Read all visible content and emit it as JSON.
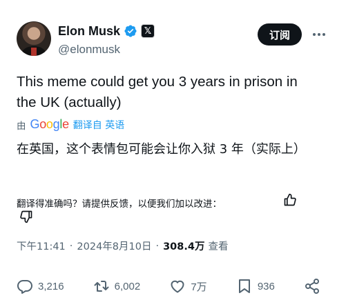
{
  "author": {
    "display_name": "Elon Musk",
    "handle": "@elonmusk",
    "verified_icon": "verified-badge-icon",
    "affiliate_icon": "x-logo-icon",
    "brand_color": "#1d9bf0"
  },
  "header": {
    "follow_label": "订阅",
    "more_icon": "more-horizontal-icon"
  },
  "tweet": {
    "text": "This meme could get you 3 years in prison in the UK (actually)"
  },
  "translation": {
    "by_label": "由",
    "provider": "Google",
    "translated_from_label": "翻译自 英语",
    "translated_text": "在英国，这个表情包可能会让你入狱 3 年（实际上）",
    "feedback_prompt": "翻译得准确吗？请提供反馈，以便我们加以改进："
  },
  "meta": {
    "time": "下午11:41",
    "separator": "·",
    "date": "2024年8月10日",
    "views_count": "308.4万",
    "views_label": "查看"
  },
  "actions": {
    "replies": "3,216",
    "reposts": "6,002",
    "likes": "7万",
    "bookmarks": "936"
  }
}
